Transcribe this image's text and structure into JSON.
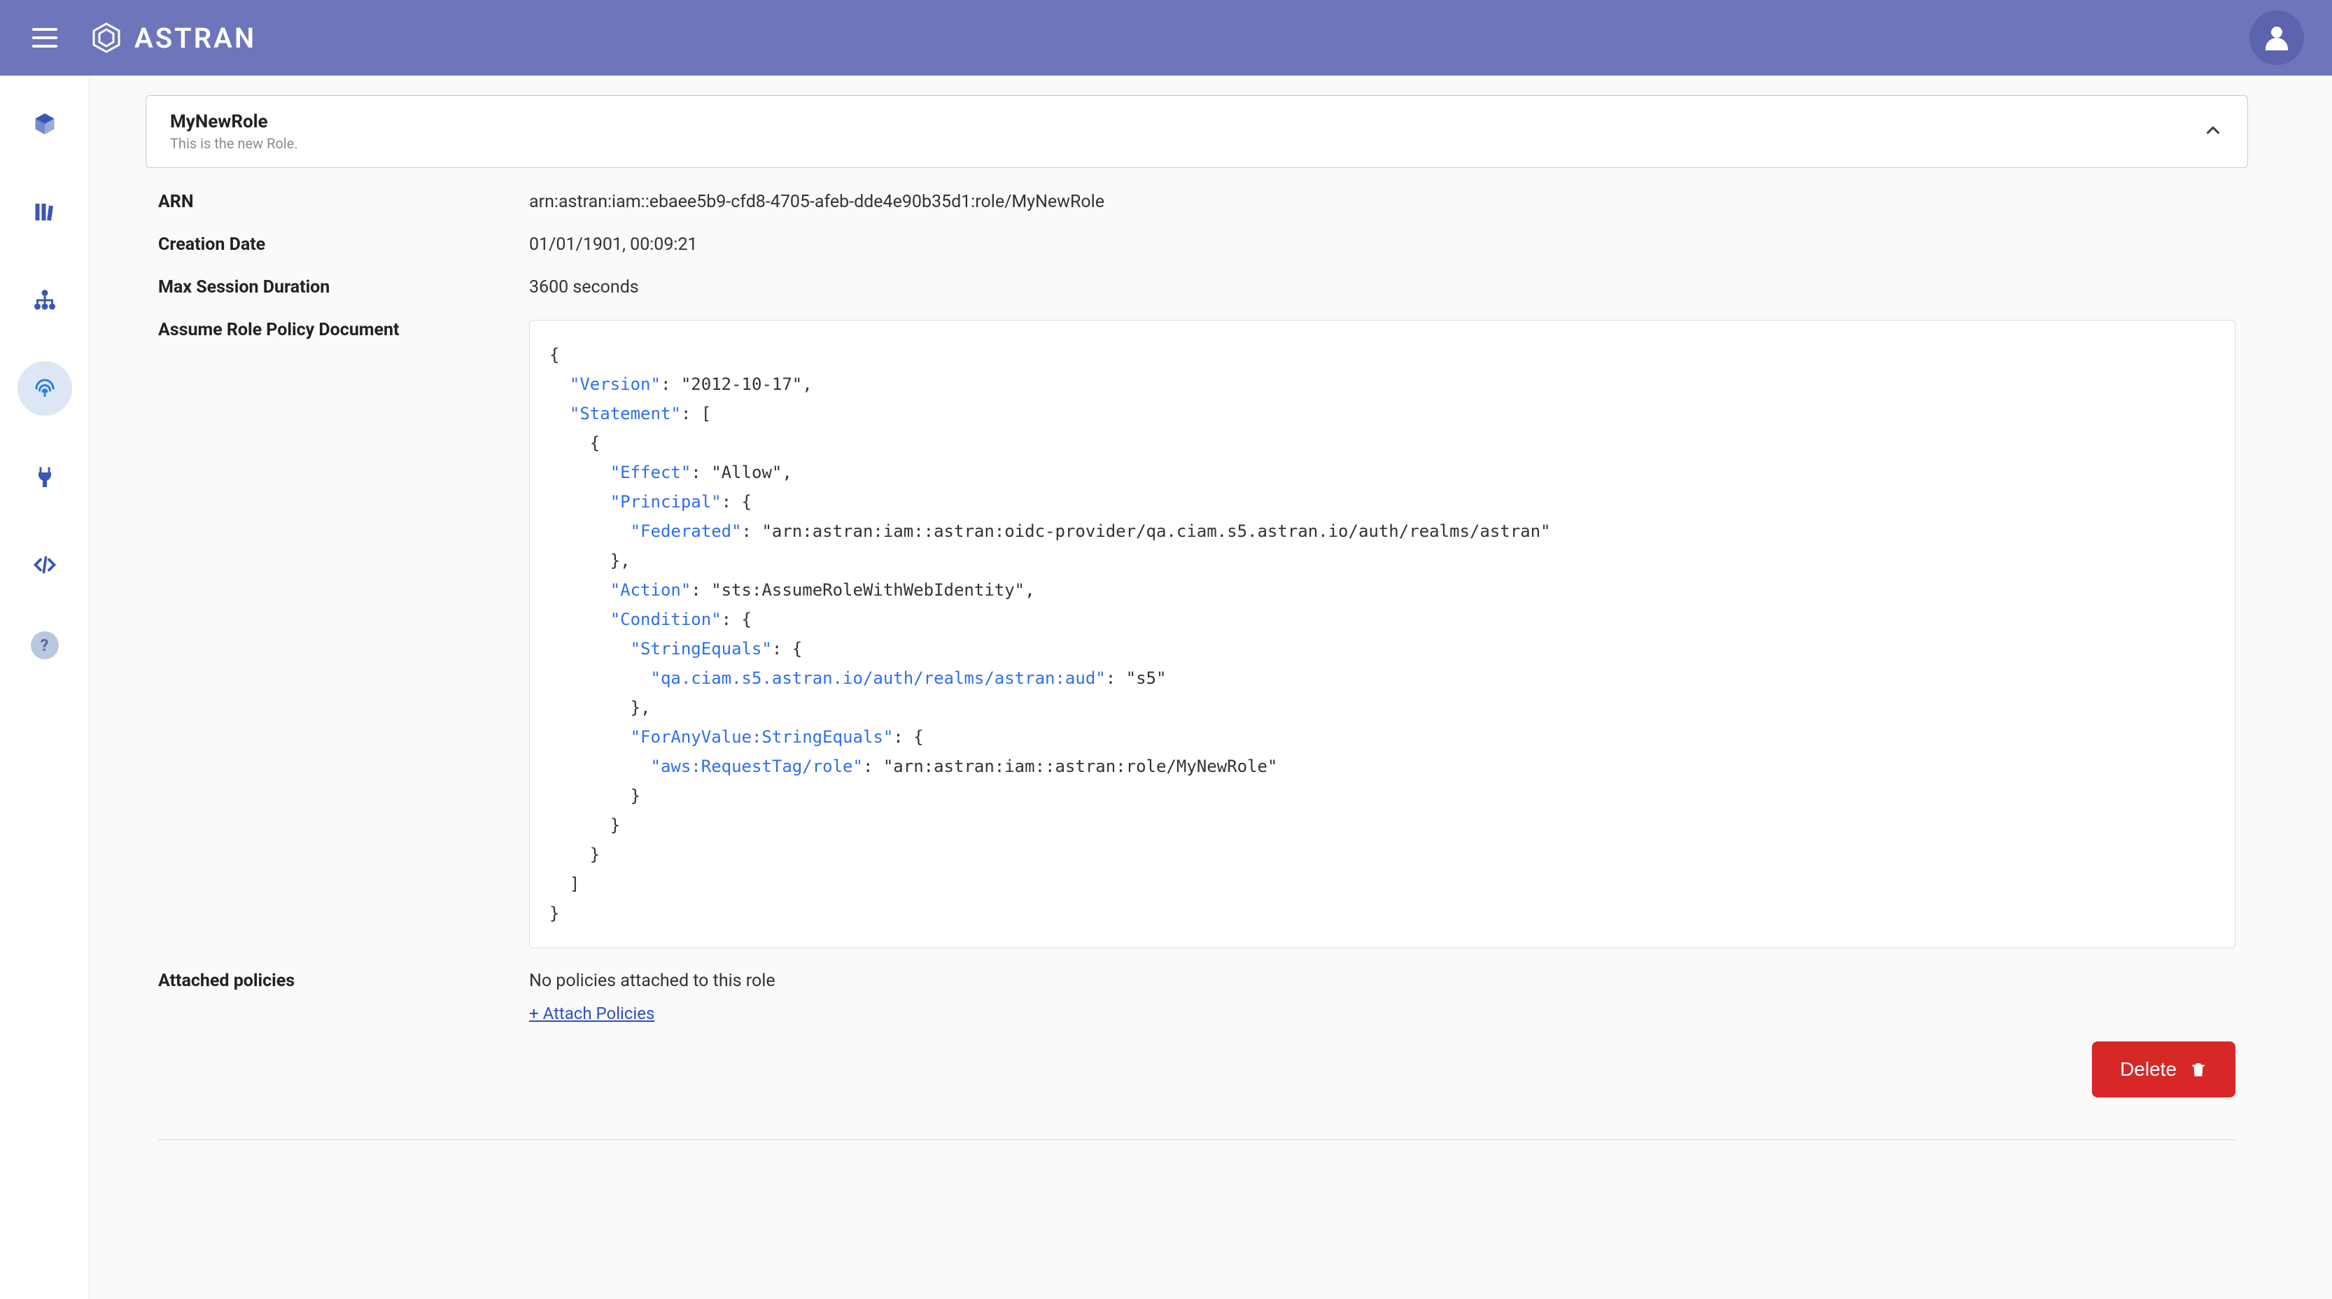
{
  "header": {
    "brand": "ASTRAN"
  },
  "role": {
    "title": "MyNewRole",
    "subtitle": "This is the new Role."
  },
  "labels": {
    "arn": "ARN",
    "creation": "Creation Date",
    "max_session": "Max Session Duration",
    "policy_doc": "Assume Role Policy Document",
    "attached": "Attached policies"
  },
  "values": {
    "arn": "arn:astran:iam::ebaee5b9-cfd8-4705-afeb-dde4e90b35d1:role/MyNewRole",
    "creation": "01/01/1901, 00:09:21",
    "max_session": "3600 seconds",
    "no_policies": "No policies attached to this role",
    "attach_link": "+ Attach Policies"
  },
  "policy": {
    "version_key": "\"Version\"",
    "version_val": "\"2012-10-17\"",
    "statement_key": "\"Statement\"",
    "effect_key": "\"Effect\"",
    "effect_val": "\"Allow\"",
    "principal_key": "\"Principal\"",
    "federated_key": "\"Federated\"",
    "federated_val": "\"arn:astran:iam::astran:oidc-provider/qa.ciam.s5.astran.io/auth/realms/astran\"",
    "action_key": "\"Action\"",
    "action_val": "\"sts:AssumeRoleWithWebIdentity\"",
    "condition_key": "\"Condition\"",
    "stringequals_key": "\"StringEquals\"",
    "aud_key": "\"qa.ciam.s5.astran.io/auth/realms/astran:aud\"",
    "aud_val": "\"s5\"",
    "foranyvalue_key": "\"ForAnyValue:StringEquals\"",
    "reqtag_key": "\"aws:RequestTag/role\"",
    "reqtag_val": "\"arn:astran:iam::astran:role/MyNewRole\""
  },
  "buttons": {
    "delete": "Delete"
  },
  "help": "?"
}
